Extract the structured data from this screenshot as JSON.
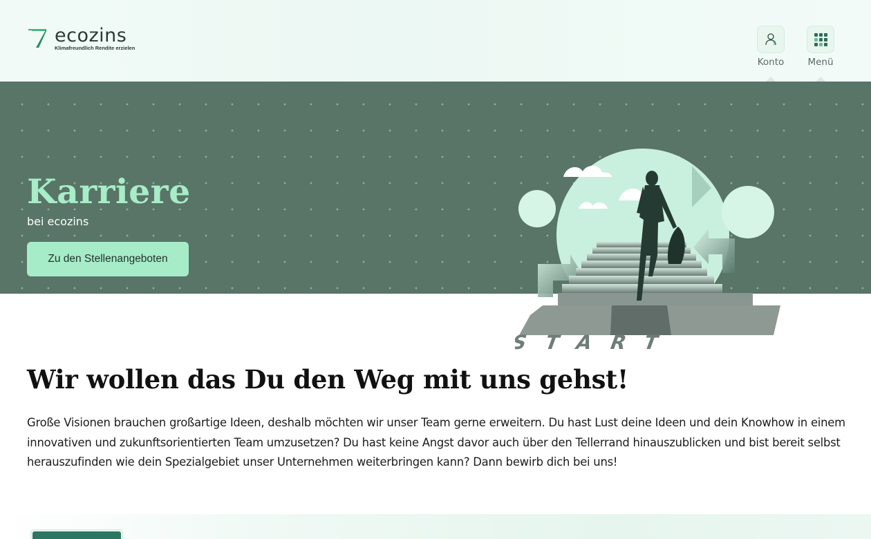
{
  "header": {
    "logo": {
      "name": "ecozins",
      "tagline": "Klimafreundlich Rendite erzielen"
    },
    "konto_label": "Konto",
    "menu_label": "Menü"
  },
  "hero": {
    "title": "Karriere",
    "subtitle": "bei ecozins",
    "cta_label": "Zu den Stellenangeboten",
    "illustration_text": "START"
  },
  "content": {
    "headline": "Wir wollen das Du den Weg mit uns gehst!",
    "paragraph": "Große Visionen brauchen großartige Ideen, deshalb möchten wir unser Team gerne erweitern. Du hast Lust deine Ideen und dein Knowhow in einem innovativen und zukunftsorientierten Team umzusetzen? Du hast keine Angst davor auch über den Tellerrand hinauszublicken und bist bereit selbst herauszufinden wie dein Spezialgebiet unser Unternehmen weiterbringen kann? Dann bewirb dich bei uns!"
  },
  "colors": {
    "hero_bg": "#587567",
    "accent_mint": "#a8ecc8",
    "brand_green": "#2f6e55"
  },
  "icons": {
    "konto": "user-icon",
    "menu": "grid-menu-icon",
    "logo": "ecozins-logo-mark"
  }
}
